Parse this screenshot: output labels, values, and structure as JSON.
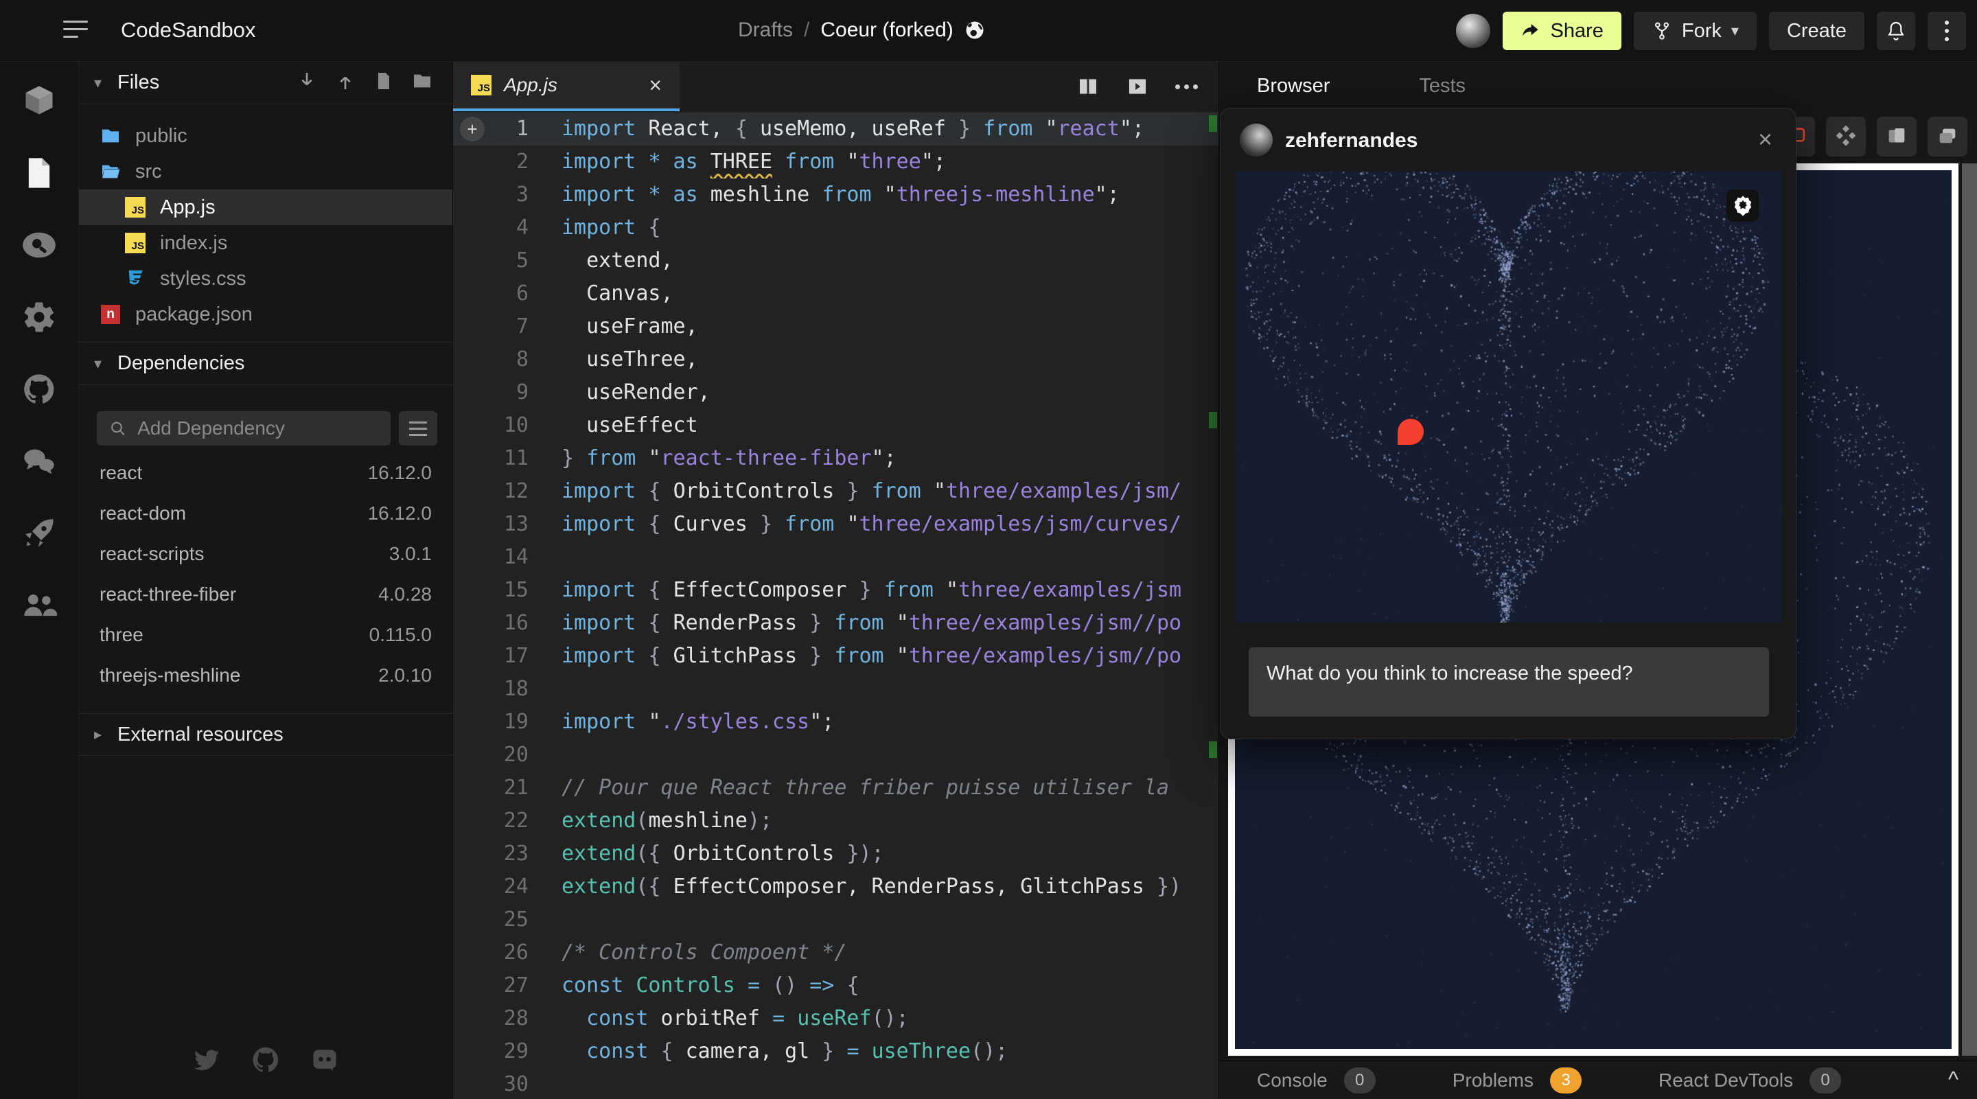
{
  "topbar": {
    "app_title": "CodeSandbox",
    "breadcrumb": {
      "root": "Drafts",
      "separator": "/",
      "current": "Coeur (forked)"
    },
    "share_label": "Share",
    "fork_label": "Fork",
    "create_label": "Create"
  },
  "rail": {
    "icons": [
      "cube",
      "file",
      "search",
      "gear",
      "github",
      "chat",
      "rocket",
      "users"
    ]
  },
  "files_panel": {
    "header": "Files",
    "toolbar_icons": [
      "download",
      "upload",
      "new-file",
      "new-folder"
    ],
    "items": [
      {
        "name": "public",
        "type": "folder",
        "indent": 0,
        "selected": false
      },
      {
        "name": "src",
        "type": "folder-open",
        "indent": 0,
        "selected": false
      },
      {
        "name": "App.js",
        "type": "js",
        "indent": 1,
        "selected": true
      },
      {
        "name": "index.js",
        "type": "js",
        "indent": 1,
        "selected": false
      },
      {
        "name": "styles.css",
        "type": "css",
        "indent": 1,
        "selected": false
      },
      {
        "name": "package.json",
        "type": "npm",
        "indent": 0,
        "selected": false
      }
    ]
  },
  "dependencies": {
    "header": "Dependencies",
    "search_placeholder": "Add Dependency",
    "items": [
      {
        "name": "react",
        "version": "16.12.0"
      },
      {
        "name": "react-dom",
        "version": "16.12.0"
      },
      {
        "name": "react-scripts",
        "version": "3.0.1"
      },
      {
        "name": "react-three-fiber",
        "version": "4.0.28"
      },
      {
        "name": "three",
        "version": "0.115.0"
      },
      {
        "name": "threejs-meshline",
        "version": "2.0.10"
      }
    ]
  },
  "external_resources": {
    "header": "External resources"
  },
  "footer_icons": [
    "twitter",
    "github",
    "discord"
  ],
  "editor": {
    "tab_label": "App.js",
    "toolbar_icons": [
      "split-view",
      "open-preview",
      "more"
    ],
    "lines": [
      {
        "tokens": [
          [
            "kw",
            "import"
          ],
          [
            "id",
            " React, "
          ],
          [
            "p",
            "{ "
          ],
          [
            "id",
            "useMemo, useRef"
          ],
          [
            "p",
            " } "
          ],
          [
            "kw",
            "from "
          ],
          [
            "q",
            "\""
          ],
          [
            "str",
            "react"
          ],
          [
            "q",
            "\";"
          ]
        ]
      },
      {
        "tokens": [
          [
            "kw",
            "import "
          ],
          [
            "kw",
            "* as "
          ],
          [
            "warn",
            "THREE"
          ],
          [
            "kw",
            " from "
          ],
          [
            "q",
            "\""
          ],
          [
            "str",
            "three"
          ],
          [
            "q",
            "\";"
          ]
        ]
      },
      {
        "tokens": [
          [
            "kw",
            "import "
          ],
          [
            "kw",
            "* as "
          ],
          [
            "id",
            "meshline "
          ],
          [
            "kw",
            "from "
          ],
          [
            "q",
            "\""
          ],
          [
            "str",
            "threejs-meshline"
          ],
          [
            "q",
            "\";"
          ]
        ]
      },
      {
        "tokens": [
          [
            "kw",
            "import "
          ],
          [
            "p",
            "{"
          ]
        ]
      },
      {
        "tokens": [
          [
            "id",
            "  extend,"
          ]
        ]
      },
      {
        "tokens": [
          [
            "id",
            "  Canvas,"
          ]
        ]
      },
      {
        "tokens": [
          [
            "id",
            "  useFrame,"
          ]
        ]
      },
      {
        "tokens": [
          [
            "id",
            "  useThree,"
          ]
        ]
      },
      {
        "tokens": [
          [
            "id",
            "  useRender,"
          ]
        ]
      },
      {
        "tokens": [
          [
            "id",
            "  useEffect"
          ]
        ]
      },
      {
        "tokens": [
          [
            "p",
            "} "
          ],
          [
            "kw",
            "from "
          ],
          [
            "q",
            "\""
          ],
          [
            "str",
            "react-three-fiber"
          ],
          [
            "q",
            "\";"
          ]
        ]
      },
      {
        "tokens": [
          [
            "kw",
            "import "
          ],
          [
            "p",
            "{ "
          ],
          [
            "id",
            "OrbitControls"
          ],
          [
            "p",
            " } "
          ],
          [
            "kw",
            "from "
          ],
          [
            "q",
            "\""
          ],
          [
            "str",
            "three/examples/jsm/"
          ]
        ]
      },
      {
        "tokens": [
          [
            "kw",
            "import "
          ],
          [
            "p",
            "{ "
          ],
          [
            "id",
            "Curves"
          ],
          [
            "p",
            " } "
          ],
          [
            "kw",
            "from "
          ],
          [
            "q",
            "\""
          ],
          [
            "str",
            "three/examples/jsm/curves/"
          ]
        ]
      },
      {
        "tokens": []
      },
      {
        "tokens": [
          [
            "kw",
            "import "
          ],
          [
            "p",
            "{ "
          ],
          [
            "id",
            "EffectComposer"
          ],
          [
            "p",
            " } "
          ],
          [
            "kw",
            "from "
          ],
          [
            "q",
            "\""
          ],
          [
            "str",
            "three/examples/jsm"
          ]
        ]
      },
      {
        "tokens": [
          [
            "kw",
            "import "
          ],
          [
            "p",
            "{ "
          ],
          [
            "id",
            "RenderPass"
          ],
          [
            "p",
            " } "
          ],
          [
            "kw",
            "from "
          ],
          [
            "q",
            "\""
          ],
          [
            "str",
            "three/examples/jsm//po"
          ]
        ]
      },
      {
        "tokens": [
          [
            "kw",
            "import "
          ],
          [
            "p",
            "{ "
          ],
          [
            "id",
            "GlitchPass"
          ],
          [
            "p",
            " } "
          ],
          [
            "kw",
            "from "
          ],
          [
            "q",
            "\""
          ],
          [
            "str",
            "three/examples/jsm//po"
          ]
        ]
      },
      {
        "tokens": []
      },
      {
        "tokens": [
          [
            "kw",
            "import "
          ],
          [
            "q",
            "\""
          ],
          [
            "str",
            "./styles.css"
          ],
          [
            "q",
            "\";"
          ]
        ]
      },
      {
        "tokens": []
      },
      {
        "tokens": [
          [
            "cmt",
            "// Pour que React three friber puisse utiliser la"
          ]
        ]
      },
      {
        "tokens": [
          [
            "fn",
            "extend"
          ],
          [
            "p",
            "("
          ],
          [
            "id",
            "meshline"
          ],
          [
            "p",
            ");"
          ]
        ]
      },
      {
        "tokens": [
          [
            "fn",
            "extend"
          ],
          [
            "p",
            "({ "
          ],
          [
            "id",
            "OrbitControls"
          ],
          [
            "p",
            " });"
          ]
        ]
      },
      {
        "tokens": [
          [
            "fn",
            "extend"
          ],
          [
            "p",
            "({ "
          ],
          [
            "id",
            "EffectComposer, RenderPass, GlitchPass"
          ],
          [
            "p",
            " })"
          ]
        ]
      },
      {
        "tokens": []
      },
      {
        "tokens": [
          [
            "cmt",
            "/* Controls Compoent */"
          ]
        ]
      },
      {
        "tokens": [
          [
            "kw",
            "const "
          ],
          [
            "fn",
            "Controls "
          ],
          [
            "kw",
            "= "
          ],
          [
            "p",
            "() "
          ],
          [
            "kw",
            "=> "
          ],
          [
            "p",
            "{"
          ]
        ]
      },
      {
        "tokens": [
          [
            "id",
            "  "
          ],
          [
            "kw",
            "const "
          ],
          [
            "id",
            "orbitRef "
          ],
          [
            "kw",
            "= "
          ],
          [
            "fn",
            "useRef"
          ],
          [
            "p",
            "();"
          ]
        ]
      },
      {
        "tokens": [
          [
            "id",
            "  "
          ],
          [
            "kw",
            "const "
          ],
          [
            "p",
            "{ "
          ],
          [
            "id",
            "camera, gl"
          ],
          [
            "p",
            " } "
          ],
          [
            "kw",
            "= "
          ],
          [
            "fn",
            "useThree"
          ],
          [
            "p",
            "();"
          ]
        ]
      },
      {
        "tokens": []
      }
    ]
  },
  "preview": {
    "tabs": {
      "browser": "Browser",
      "tests": "Tests"
    },
    "action_icons": [
      "comment",
      "responsive",
      "devices",
      "windows"
    ],
    "statusbar": [
      {
        "label": "Console",
        "count": "0",
        "warn": false
      },
      {
        "label": "Problems",
        "count": "3",
        "warn": true
      },
      {
        "label": "React DevTools",
        "count": "0",
        "warn": false
      }
    ]
  },
  "comment_popup": {
    "username": "zehfernandes",
    "comment_text": "What do you think to increase the speed?"
  },
  "colors": {
    "accent_share": "#EAFF94",
    "problems_badge": "#F0A22E",
    "comment_pin": "#F4402F",
    "canvas_bg": "#161d31",
    "particle": "#98a5d0"
  }
}
